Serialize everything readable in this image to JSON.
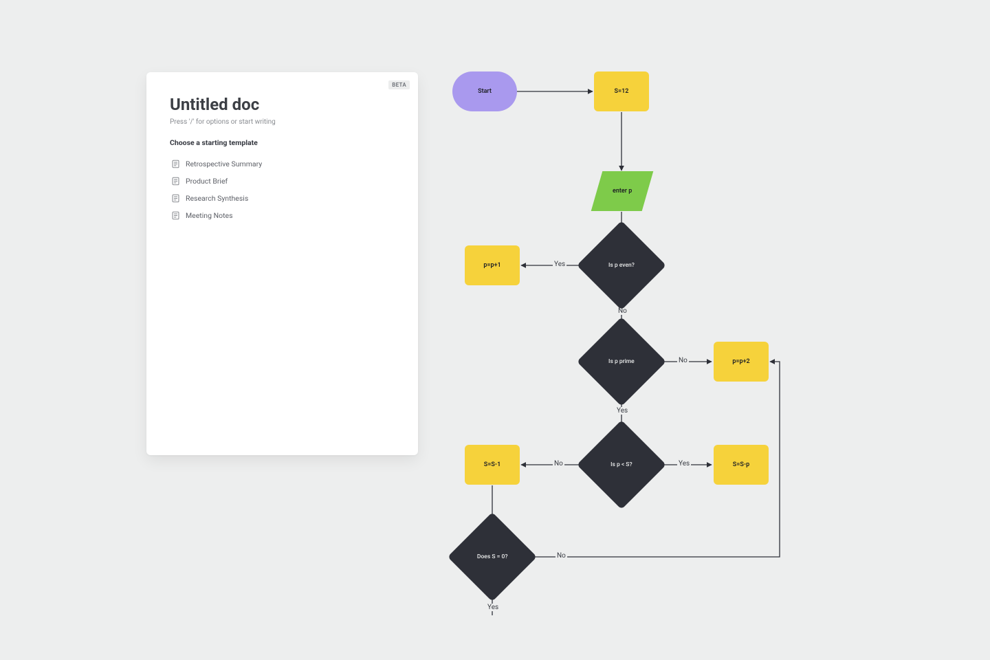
{
  "doc": {
    "badge": "BETA",
    "title": "Untitled doc",
    "hint": "Press '/' for options or start writing",
    "section_label": "Choose a starting template",
    "templates": [
      "Retrospective Summary",
      "Product Brief",
      "Research Synthesis",
      "Meeting Notes"
    ]
  },
  "flow": {
    "nodes": {
      "start": "Start",
      "s_init": "S=12",
      "enter_p": "enter p",
      "p_even": "Is p even?",
      "p_plus1": "p=p+1",
      "p_prime": "Is p prime",
      "p_plus2": "p=p+2",
      "p_lt_s": "Is p < S?",
      "s_minus1": "S=S-1",
      "s_minus_p": "S=S-p",
      "s_zero": "Does S = 0?"
    },
    "edge_labels": {
      "yes": "Yes",
      "no": "No"
    }
  }
}
